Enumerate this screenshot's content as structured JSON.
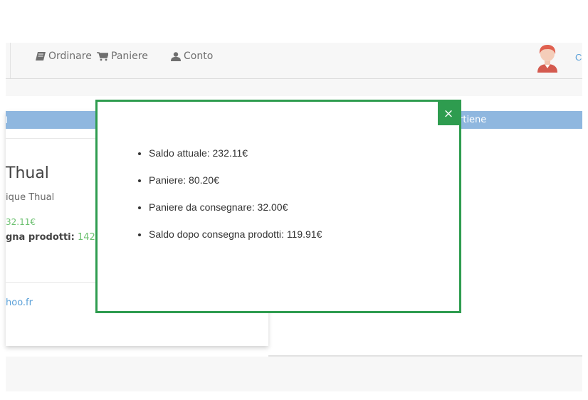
{
  "nav": {
    "ordinare": "Ordinare",
    "paniere": "Paniere",
    "conto": "Conto",
    "user_cut": "C"
  },
  "icons": [
    "book-icon",
    "cart-icon",
    "user-icon",
    "avatar-icon",
    "close-icon"
  ],
  "colors": {
    "modal_border": "#2e9c4f",
    "panel_header": "#8fb7df",
    "green_text": "#6cc070",
    "link_blue": "#5aa0d8"
  },
  "background": {
    "left_header_cut": "l",
    "right_header_cut": "rtiene",
    "name_big": "Thual",
    "name_small": "ique Thual",
    "balance_cut": "32.11€",
    "consegna_label": "gna prodotti:",
    "consegna_value": "142",
    "email_cut": "hoo.fr"
  },
  "modal": {
    "close_label": "×",
    "items": [
      "Saldo attuale: 232.11€",
      "Paniere: 80.20€",
      "Paniere da consegnare: 32.00€",
      "Saldo dopo consegna prodotti: 119.91€"
    ]
  }
}
